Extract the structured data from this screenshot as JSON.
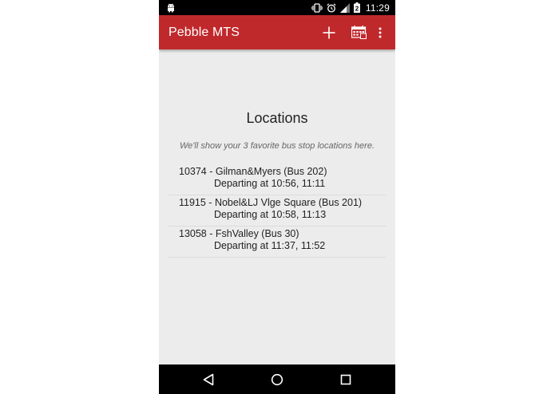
{
  "status_bar": {
    "time": "11:29",
    "battery_level": "2",
    "icons": [
      "android-icon",
      "vibrate-icon",
      "alarm-icon",
      "signal-icon",
      "battery-icon"
    ]
  },
  "app_bar": {
    "title": "Pebble MTS",
    "background_color": "#c0292c",
    "actions": [
      "add-icon",
      "calendar-icon",
      "overflow-menu-icon"
    ]
  },
  "main": {
    "heading": "Locations",
    "subtitle": "We'll show your 3 favorite bus stop locations here.",
    "locations": [
      {
        "title": "10374 - Gilman&Myers (Bus 202)",
        "departures": "Departing at 10:56, 11:11"
      },
      {
        "title": "11915 - Nobel&LJ Vlge Square (Bus 201)",
        "departures": "Departing at 10:58, 11:13"
      },
      {
        "title": "13058 - FshValley (Bus 30)",
        "departures": "Departing at 11:37, 11:52"
      }
    ]
  },
  "nav_bar": {
    "buttons": [
      "back-icon",
      "home-icon",
      "recents-icon"
    ]
  }
}
